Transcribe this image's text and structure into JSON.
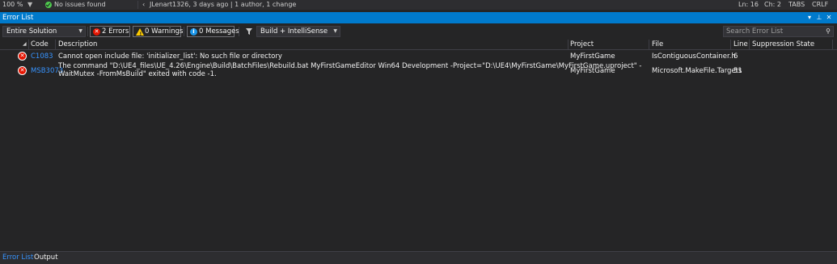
{
  "status_strip": {
    "zoom": "100 %",
    "issues": "No issues found",
    "git_info": "JLenart1326, 3 days ago | 1 author, 1 change",
    "line": "Ln: 16",
    "column": "Ch: 2",
    "indent": "TABS",
    "line_ending": "CRLF"
  },
  "panel": {
    "title": "Error List"
  },
  "toolbar": {
    "scope": "Entire Solution",
    "errors_label": "2 Errors",
    "warnings_label": "0 Warnings",
    "messages_label": "0 Messages",
    "build_filter": "Build + IntelliSense",
    "search_placeholder": "Search Error List"
  },
  "columns": {
    "code": "Code",
    "description": "Description",
    "project": "Project",
    "file": "File",
    "line": "Line",
    "suppression": "Suppression State"
  },
  "errors": [
    {
      "code": "C1083",
      "description_line1": "Cannot open include file: 'initializer_list': No such file or directory",
      "description_line2": "",
      "project": "MyFirstGame",
      "file": "IsContiguousContainer.h",
      "line": "6"
    },
    {
      "code": "MSB3073",
      "description_line1": "The command \"D:\\UE4_files\\UE_4.26\\Engine\\Build\\BatchFiles\\Rebuild.bat MyFirstGameEditor Win64 Development -Project=\"D:\\UE4\\MyFirstGame\\MyFirstGame.uproject\" -",
      "description_line2": "WaitMutex -FromMsBuild\" exited with code -1.",
      "project": "MyFirstGame",
      "file": "Microsoft.MakeFile.Targets",
      "line": "51"
    }
  ],
  "bottom_tabs": [
    "Error List",
    "Output"
  ],
  "colors": {
    "accent": "#007acc",
    "error": "#e51400",
    "warning": "#ffcc00",
    "info": "#1c97ea",
    "link": "#3794ff",
    "ok": "#4ec94e"
  }
}
